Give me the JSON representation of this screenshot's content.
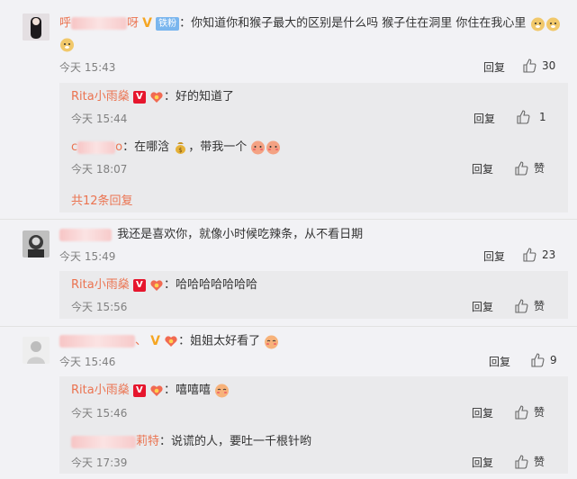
{
  "comments": [
    {
      "name_tail": "呀",
      "name_head": "呼",
      "badge": "铁粉",
      "text": "你知道你和猴子最大的区别是什么吗 猴子住在洞里 你住在我心里",
      "time": "今天 15:43",
      "reply": "回复",
      "likes": "30",
      "subreplies": [
        {
          "name": "Rita小雨燊",
          "text": "好的知道了",
          "time": "今天 15:44",
          "reply": "回复",
          "likes": "1"
        },
        {
          "name_head": "c",
          "name_tail": "o",
          "text": "在哪浛",
          "text2": "，带我一个",
          "time": "今天 18:07",
          "reply": "回复",
          "likes": "赞"
        }
      ],
      "more": "共12条回复"
    },
    {
      "text": "我还是喜欢你，就像小时候吃辣条，从不看日期",
      "time": "今天 15:49",
      "reply": "回复",
      "likes": "23",
      "subreplies": [
        {
          "name": "Rita小雨燊",
          "text": "哈哈哈哈哈哈哈",
          "time": "今天 15:56",
          "reply": "回复",
          "likes": "赞"
        }
      ]
    },
    {
      "name_head": "",
      "name_tail": "、",
      "text": "姐姐太好看了",
      "time": "今天 15:46",
      "reply": "回复",
      "likes": "9",
      "subreplies": [
        {
          "name": "Rita小雨燊",
          "text": "嘻嘻嘻",
          "time": "今天 15:46",
          "reply": "回复",
          "likes": "赞"
        },
        {
          "name_tail": "莉特",
          "text": "说谎的人，要吐一千根针哟",
          "time": "今天 17:39",
          "reply": "回复",
          "likes": "赞"
        }
      ]
    }
  ],
  "colors": {
    "name": "#eb7350",
    "background": "#f2f2f5",
    "subbox": "#eaeaec"
  },
  "icons": [
    "thumbs-up-icon",
    "verified-v-icon",
    "heart-badge-icon",
    "money-bag-icon",
    "doge-emoji",
    "blush-emoji"
  ]
}
